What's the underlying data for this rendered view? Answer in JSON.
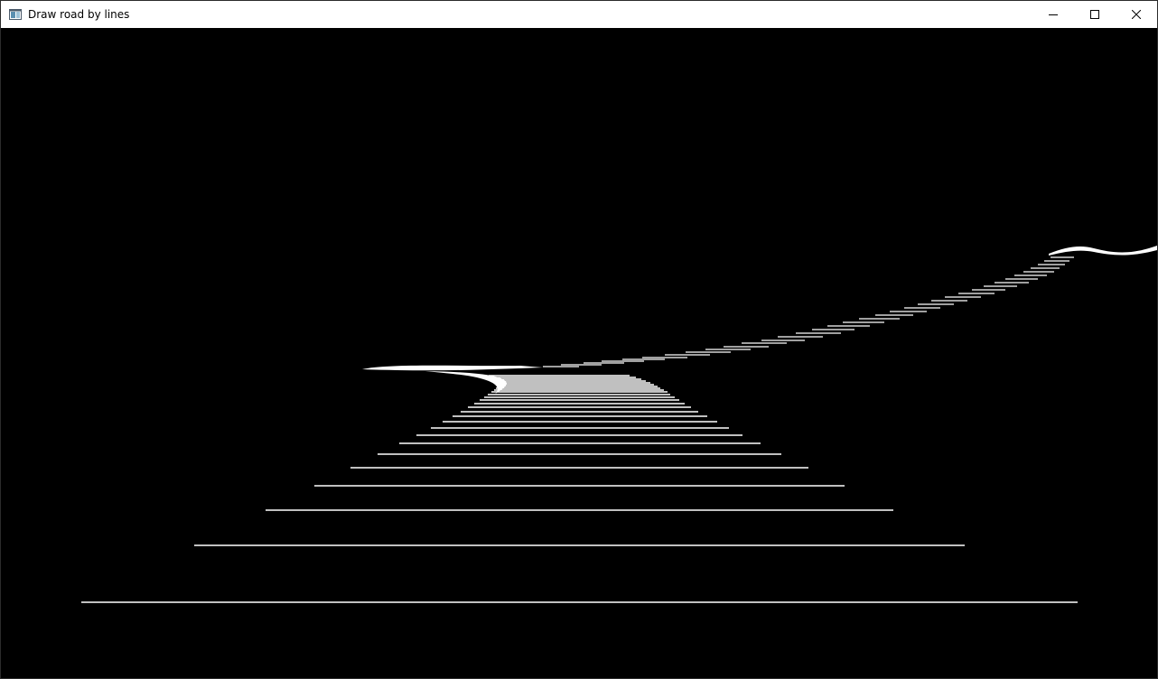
{
  "window": {
    "title": "Draw road by lines",
    "app_icon": "window-app-icon",
    "controls": {
      "minimize_icon": "minimize-icon",
      "maximize_icon": "maximize-icon",
      "close_icon": "close-icon"
    }
  },
  "canvas": {
    "background_color": "#000000",
    "line_color": "#ffffff"
  }
}
